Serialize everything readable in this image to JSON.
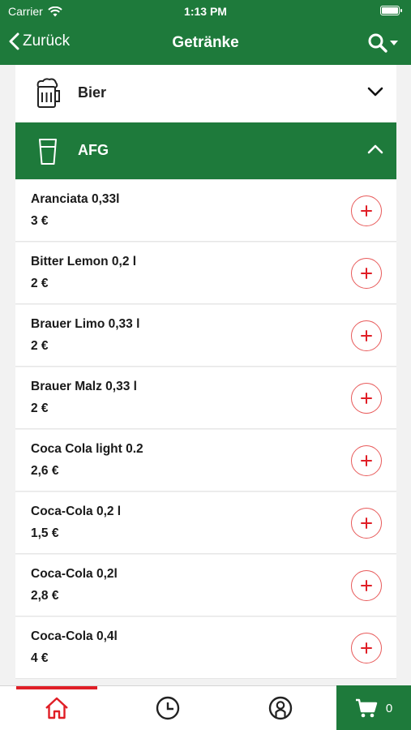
{
  "status": {
    "carrier": "Carrier",
    "time": "1:13 PM"
  },
  "nav": {
    "back_label": "Zurück",
    "title": "Getränke"
  },
  "categories": [
    {
      "label": "Bier",
      "icon": "beer-mug-icon",
      "expanded": false
    },
    {
      "label": "AFG",
      "icon": "glass-icon",
      "expanded": true
    }
  ],
  "items": [
    {
      "name": "Aranciata 0,33l",
      "price": "3 €"
    },
    {
      "name": "Bitter Lemon 0,2 l",
      "price": "2 €"
    },
    {
      "name": "Brauer Limo 0,33 l",
      "price": "2 €"
    },
    {
      "name": "Brauer Malz 0,33 l",
      "price": "2 €"
    },
    {
      "name": "Coca Cola light 0.2",
      "price": "2,6 €"
    },
    {
      "name": "Coca-Cola 0,2 l",
      "price": "1,5 €"
    },
    {
      "name": "Coca-Cola 0,2l",
      "price": "2,8 €"
    },
    {
      "name": "Coca-Cola 0,4l",
      "price": "4 €"
    }
  ],
  "tabbar": {
    "cart_count": "0"
  },
  "colors": {
    "primary": "#1e7a3b",
    "accent": "#e01e26"
  }
}
